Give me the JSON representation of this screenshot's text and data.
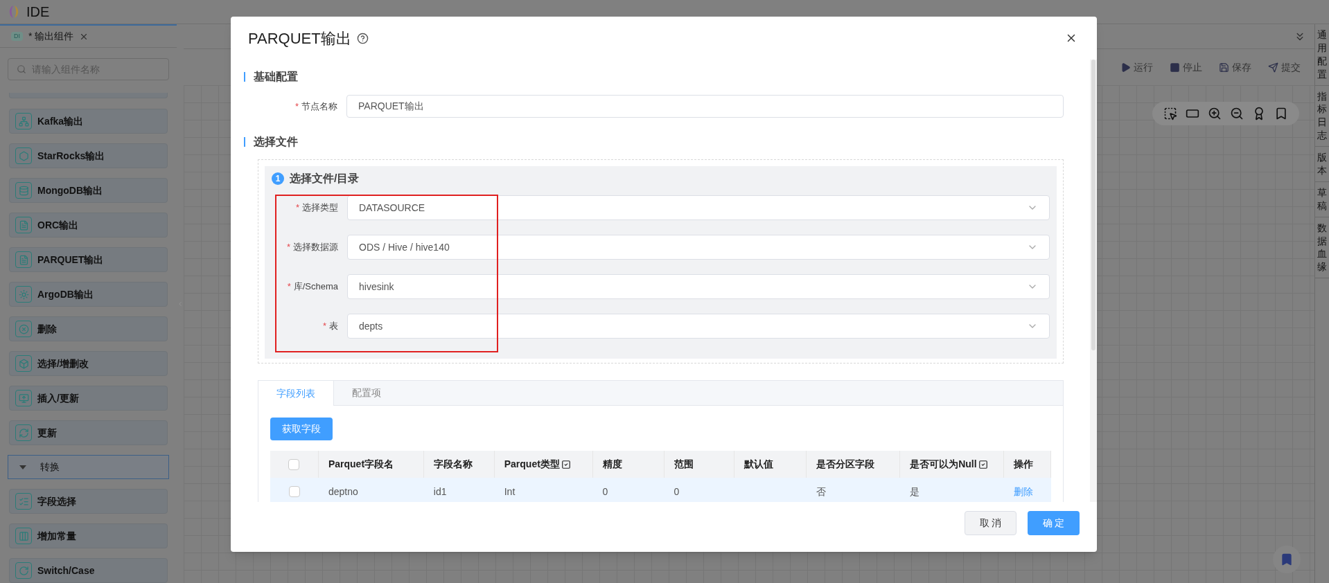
{
  "app": {
    "title": "IDE"
  },
  "editor_tab": {
    "badge": "DI",
    "label": "* 输出组件"
  },
  "sidebar": {
    "search": {
      "placeholder": "请输入组件名称"
    },
    "items": [
      {
        "kind": "component",
        "label": "Kafka输出"
      },
      {
        "kind": "component",
        "label": "StarRocks输出"
      },
      {
        "kind": "component",
        "label": "MongoDB输出"
      },
      {
        "kind": "component",
        "label": "ORC输出"
      },
      {
        "kind": "component",
        "label": "PARQUET输出"
      },
      {
        "kind": "component",
        "label": "ArgoDB输出"
      },
      {
        "kind": "component",
        "label": "删除"
      },
      {
        "kind": "component",
        "label": "选择/增删改"
      },
      {
        "kind": "component",
        "label": "插入/更新"
      },
      {
        "kind": "component",
        "label": "更新"
      },
      {
        "kind": "group",
        "label": "转换",
        "expanded": true
      },
      {
        "kind": "component",
        "label": "字段选择"
      },
      {
        "kind": "component",
        "label": "增加常量"
      },
      {
        "kind": "component",
        "label": "Switch/Case"
      }
    ]
  },
  "toolbar": {
    "actions": [
      {
        "kind": "run",
        "label": "运行"
      },
      {
        "kind": "stop",
        "label": "停止"
      },
      {
        "kind": "save",
        "label": "保存"
      },
      {
        "kind": "submit",
        "label": "提交"
      }
    ]
  },
  "right_tabs": [
    "通用配置",
    "指标日志",
    "版本",
    "草稿",
    "数据血缘"
  ],
  "dialog": {
    "title": "PARQUET输出",
    "basic": {
      "heading": "基础配置",
      "fields": [
        {
          "kind": "input",
          "required_mark": "*",
          "label": "节点名称",
          "value": "PARQUET输出"
        }
      ]
    },
    "file": {
      "heading": "选择文件",
      "step": {
        "number": "1",
        "title": "选择文件/目录"
      },
      "fields": [
        {
          "kind": "select",
          "required_mark": "*",
          "label": "选择类型",
          "value": "DATASOURCE"
        },
        {
          "kind": "select",
          "required_mark": "*",
          "label": "选择数据源",
          "value": "ODS / Hive / hive140"
        },
        {
          "kind": "select",
          "required_mark": "*",
          "label": "库/Schema",
          "value": "hivesink"
        },
        {
          "kind": "select",
          "required_mark": "*",
          "label": "表",
          "value": "depts"
        }
      ]
    },
    "tabs": [
      {
        "label": "字段列表",
        "selected": true
      },
      {
        "label": "配置项",
        "selected": false
      }
    ],
    "fetch_button": "获取字段",
    "table": {
      "header_checked": false,
      "columns": [
        {
          "label": "Parquet字段名",
          "bulk_edit": false
        },
        {
          "label": "字段名称",
          "bulk_edit": false
        },
        {
          "label": "Parquet类型",
          "bulk_edit": true
        },
        {
          "label": "精度",
          "bulk_edit": false
        },
        {
          "label": "范围",
          "bulk_edit": false
        },
        {
          "label": "默认值",
          "bulk_edit": false
        },
        {
          "label": "是否分区字段",
          "bulk_edit": false
        },
        {
          "label": "是否可以为Null",
          "bulk_edit": true
        },
        {
          "label": "操作",
          "bulk_edit": false
        }
      ],
      "rows": [
        {
          "checked": false,
          "hovered": true,
          "cells": [
            "deptno",
            "id1",
            "Int",
            "0",
            "0",
            "",
            "否",
            "是"
          ],
          "action": "删除"
        }
      ]
    },
    "buttons": [
      {
        "kind": "secondary",
        "label": "取 消"
      },
      {
        "kind": "primary",
        "label": "确 定"
      }
    ]
  }
}
